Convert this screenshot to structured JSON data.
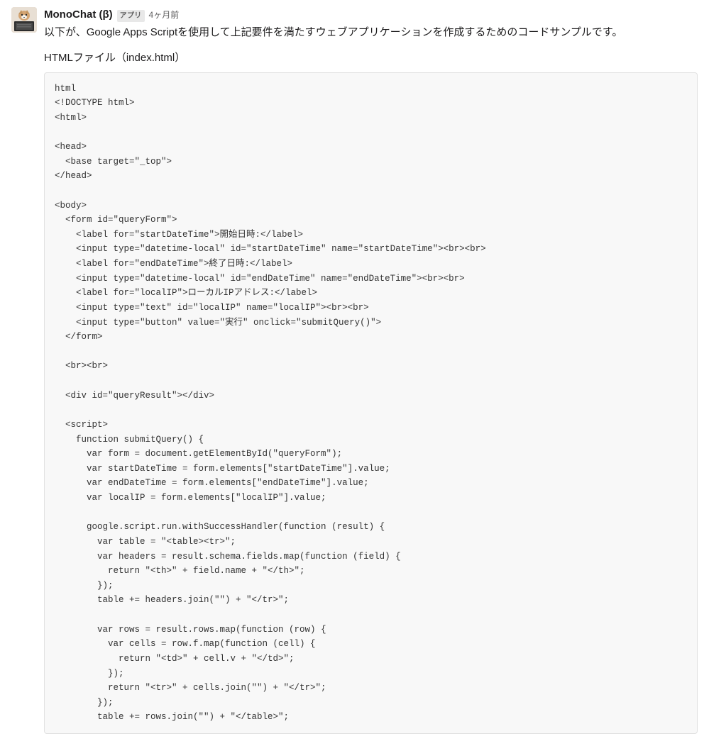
{
  "message": {
    "username": "MonoChat (β)",
    "app_badge": "アプリ",
    "timestamp": "4ヶ月前",
    "intro_text": "以下が、Google Apps Scriptを使用して上記要件を満たすウェブアプリケーションを作成するためのコードサンプルです。",
    "section_title": "HTMLファイル（index.html）",
    "code": "html\n<!DOCTYPE html>\n<html>\n\n<head>\n  <base target=\"_top\">\n</head>\n\n<body>\n  <form id=\"queryForm\">\n    <label for=\"startDateTime\">開始日時:</label>\n    <input type=\"datetime-local\" id=\"startDateTime\" name=\"startDateTime\"><br><br>\n    <label for=\"endDateTime\">終了日時:</label>\n    <input type=\"datetime-local\" id=\"endDateTime\" name=\"endDateTime\"><br><br>\n    <label for=\"localIP\">ローカルIPアドレス:</label>\n    <input type=\"text\" id=\"localIP\" name=\"localIP\"><br><br>\n    <input type=\"button\" value=\"実行\" onclick=\"submitQuery()\">\n  </form>\n\n  <br><br>\n\n  <div id=\"queryResult\"></div>\n\n  <script>\n    function submitQuery() {\n      var form = document.getElementById(\"queryForm\");\n      var startDateTime = form.elements[\"startDateTime\"].value;\n      var endDateTime = form.elements[\"endDateTime\"].value;\n      var localIP = form.elements[\"localIP\"].value;\n\n      google.script.run.withSuccessHandler(function (result) {\n        var table = \"<table><tr>\";\n        var headers = result.schema.fields.map(function (field) {\n          return \"<th>\" + field.name + \"</th>\";\n        });\n        table += headers.join(\"\") + \"</tr>\";\n\n        var rows = result.rows.map(function (row) {\n          var cells = row.f.map(function (cell) {\n            return \"<td>\" + cell.v + \"</td>\";\n          });\n          return \"<tr>\" + cells.join(\"\") + \"</tr>\";\n        });\n        table += rows.join(\"\") + \"</table>\";"
  }
}
